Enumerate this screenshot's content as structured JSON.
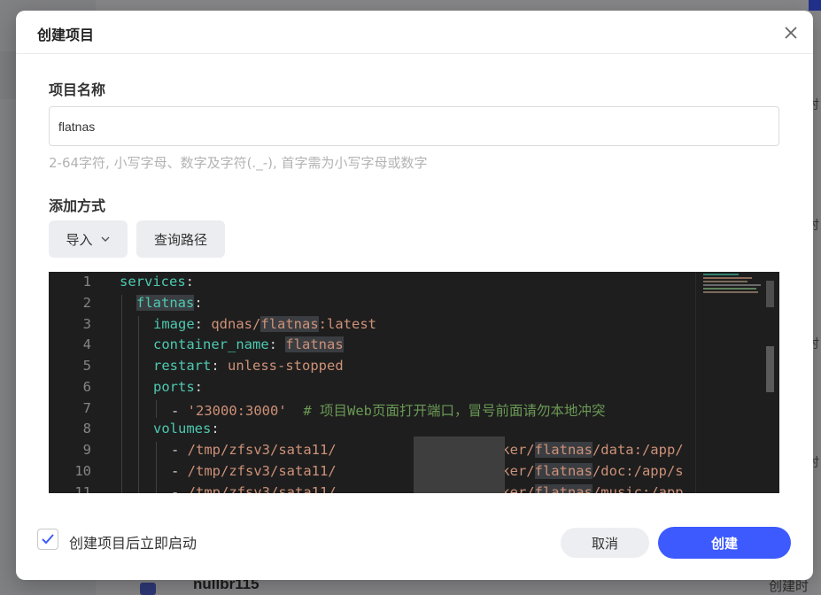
{
  "background": {
    "bottom_item_name": "nullbr115",
    "bottom_item_time": "创建时间"
  },
  "dialog": {
    "title": "创建项目",
    "close_icon": "close-icon",
    "name_label": "项目名称",
    "name_value": "flatnas",
    "name_hint": "2-64字符, 小写字母、数字及字符(._-), 首字需为小写字母或数字",
    "method_label": "添加方式",
    "import_label": "导入",
    "query_path_label": "查询路径",
    "editor": {
      "line_numbers": [
        "1",
        "2",
        "3",
        "4",
        "5",
        "6",
        "7",
        "8",
        "9",
        "10",
        "11"
      ],
      "lines": [
        {
          "key": "services",
          "punct": ":"
        },
        {
          "key": "flatnas",
          "punct": ":"
        },
        {
          "key": "image",
          "punct": ": ",
          "value_pre": "qdnas/",
          "value_hl": "flatnas",
          "value_post": ":latest"
        },
        {
          "key": "container_name",
          "punct": ": ",
          "value_hl": "flatnas"
        },
        {
          "key": "restart",
          "punct": ": ",
          "value_post": "unless-stopped"
        },
        {
          "key": "ports",
          "punct": ":"
        },
        {
          "dash": "- ",
          "value_post": "'23000:3000'",
          "comment": "  # 项目Web页面打开端口，冒号前面请勿本地冲突"
        },
        {
          "key": "volumes",
          "punct": ":"
        },
        {
          "dash": "- ",
          "value_pre": "/tmp/zfsv3/sata11/",
          "value_gap": "           ",
          "value_mid": "/data/Docker/",
          "value_hl": "flatnas",
          "value_post": "/data:/app/"
        },
        {
          "dash": "- ",
          "value_pre": "/tmp/zfsv3/sata11/",
          "value_gap": "           ",
          "value_mid": "/data/Docker/",
          "value_hl": "flatnas",
          "value_post": "/doc:/app/s"
        },
        {
          "dash": "- ",
          "value_pre": "/tmp/zfsv3/sata11/",
          "value_gap": "           ",
          "value_mid": "/data/Docker/",
          "value_hl": "flatnas",
          "value_post": "/music:/app"
        }
      ]
    },
    "autostart_label": "创建项目后立即启动",
    "autostart_checked": true,
    "cancel_label": "取消",
    "create_label": "创建"
  },
  "colors": {
    "primary": "#3d5afe",
    "editor_bg": "#1e1e1e",
    "yaml_key": "#4ec9b0",
    "yaml_string": "#ce9178",
    "yaml_comment": "#6a9955"
  }
}
